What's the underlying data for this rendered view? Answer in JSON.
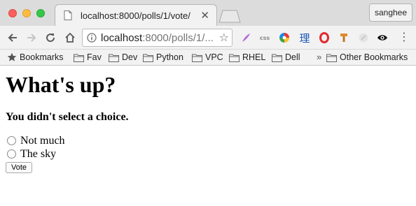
{
  "window": {
    "tab": {
      "title": "localhost:8000/polls/1/vote/"
    },
    "profile": {
      "label": "sanghee"
    }
  },
  "toolbar": {
    "url_host": "localhost",
    "url_rest": ":8000/polls/1/...",
    "extensions": {
      "css_label": "css",
      "li_label": "理"
    }
  },
  "bookmarks_bar": {
    "items": [
      {
        "label": "Bookmarks",
        "icon": "star-icon"
      },
      {
        "label": "Fav",
        "icon": "folder-icon"
      },
      {
        "label": "Dev",
        "icon": "folder-icon"
      },
      {
        "label": "Python",
        "icon": "folder-icon"
      },
      {
        "label": "VPC",
        "icon": "folder-icon"
      },
      {
        "label": "RHEL",
        "icon": "folder-icon"
      },
      {
        "label": "Dell",
        "icon": "folder-icon"
      }
    ],
    "overflow": "»",
    "other": "Other Bookmarks"
  },
  "page": {
    "heading": "What's up?",
    "error_message": "You didn't select a choice.",
    "choices": [
      {
        "label": "Not much",
        "checked": false
      },
      {
        "label": "The sky",
        "checked": false
      }
    ],
    "vote_button": "Vote"
  }
}
